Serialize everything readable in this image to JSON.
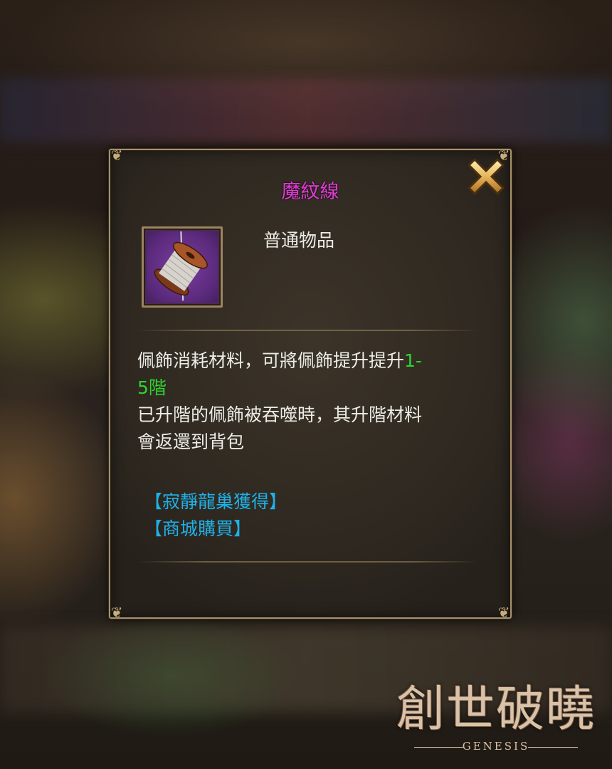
{
  "item": {
    "name": "魔紋線",
    "rarity": "普通物品",
    "icon": "thread-spool-icon",
    "name_color": "#e23bd6"
  },
  "description": {
    "line1_prefix": "佩飾消耗材料，可將佩飾提升提升",
    "line1_highlight": "1-",
    "line2_highlight": "5階",
    "line3": "已升階的佩飾被吞噬時，其升階材料",
    "line4": "會返還到背包",
    "highlight_color": "#2fd42f"
  },
  "sources": [
    "【寂靜龍巢獲得】",
    "【商城購買】"
  ],
  "close_icon": "close-x-icon",
  "logo": {
    "title": "創世破曉",
    "subtitle": "GENESIS"
  }
}
